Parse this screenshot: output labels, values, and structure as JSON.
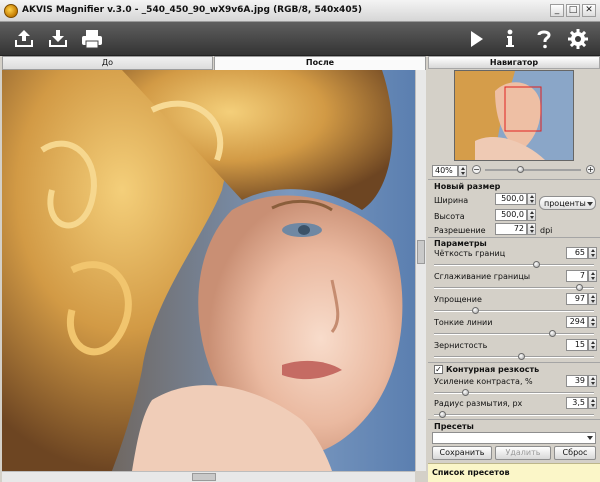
{
  "window": {
    "title": "AKVIS Magnifier v.3.0 - _540_450_90_wX9v6A.jpg (RGB/8, 540x405)",
    "min": "_",
    "max": "□",
    "close": "✕"
  },
  "toolbar": {
    "left_icons": [
      "open-icon",
      "save-icon",
      "print-icon"
    ],
    "right_icons": [
      "run-icon",
      "info-icon",
      "help-icon",
      "settings-icon"
    ]
  },
  "tabs": {
    "before": "До",
    "after": "После"
  },
  "navigator": {
    "title": "Навигатор",
    "zoom": "40%"
  },
  "new_size": {
    "title": "Новый размер",
    "width_label": "Ширина",
    "width_value": "500,0",
    "height_label": "Высота",
    "height_value": "500,0",
    "unit": "проценты",
    "resolution_label": "Разрешение",
    "resolution_value": "72",
    "resolution_unit": "dpi"
  },
  "params": {
    "title": "Параметры",
    "items": [
      {
        "label": "Чёткость границ",
        "value": "65",
        "level": 0.65
      },
      {
        "label": "Сглаживание границы",
        "value": "7",
        "level": 0.93
      },
      {
        "label": "Упрощение",
        "value": "97",
        "level": 0.25
      },
      {
        "label": "Тонкие линии",
        "value": "294",
        "level": 0.75
      },
      {
        "label": "Зернистость",
        "value": "15",
        "level": 0.55
      }
    ]
  },
  "contour": {
    "title": "Контурная резкость",
    "checked": true,
    "items": [
      {
        "label": "Усиление контраста, %",
        "value": "39",
        "level": 0.18
      },
      {
        "label": "Радиус размытия, px",
        "value": "3,5",
        "level": 0.03
      }
    ]
  },
  "presets": {
    "title": "Пресеты",
    "save": "Сохранить",
    "delete": "Удалить",
    "reset": "Сброс",
    "list_title": "Список пресетов"
  }
}
